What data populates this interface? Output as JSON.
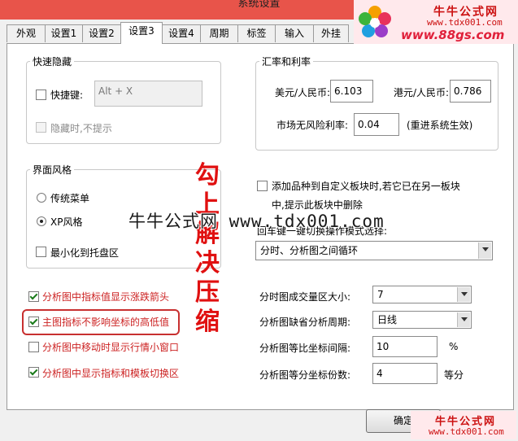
{
  "window": {
    "title": "系统设置"
  },
  "tabs": [
    "外观",
    "设置1",
    "设置2",
    "设置3",
    "设置4",
    "周期",
    "标签",
    "输入",
    "外挂"
  ],
  "active_tab": "设置3",
  "quick_hide": {
    "legend": "快速隐藏",
    "hotkey_label": "快捷键:",
    "hotkey_value": "Alt + X",
    "hide_label": "隐藏时,不提示"
  },
  "rates": {
    "legend": "汇率和利率",
    "usd_label": "美元/人民币:",
    "usd_value": "6.103",
    "hkd_label": "港元/人民币:",
    "hkd_value": "0.786",
    "riskfree_label": "市场无风险利率:",
    "riskfree_value": "0.04",
    "restart_note": "(重进系统生效)"
  },
  "style": {
    "legend": "界面风格",
    "classic_label": "传统菜单",
    "xp_label": "XP风格",
    "tray_label": "最小化到托盘区"
  },
  "custom_block": {
    "line1": "添加品种到自定义板块时,若它已在另一板块",
    "line2": "中,提示此板块中删除"
  },
  "switch_mode": {
    "label": "回车键一键切换操作模式选择:",
    "value": "分时、分析图之间循环"
  },
  "options": [
    {
      "label": "分析图中指标值显示涨跌箭头",
      "checked": true
    },
    {
      "label": "主图指标不影响坐标的高低值",
      "checked": true
    },
    {
      "label": "分析图中移动时显示行情小窗口",
      "checked": false
    },
    {
      "label": "分析图中显示指标和模板切换区",
      "checked": true
    }
  ],
  "right_fields": {
    "volume_label": "分时图成交量区大小:",
    "volume_value": "7",
    "period_label": "分析图缺省分析周期:",
    "period_value": "日线",
    "ratio_label": "分析图等比坐标间隔:",
    "ratio_value": "10",
    "ratio_unit": "%",
    "divide_label": "分析图等分坐标份数:",
    "divide_value": "4",
    "divide_unit": "等分"
  },
  "annotation": {
    "chars": [
      "勾",
      "上",
      "解",
      "决",
      "压",
      "缩"
    ]
  },
  "ok_button": "确定",
  "watermark": {
    "center": "牛牛公式网 www.tdx001.com",
    "top_brand": "牛牛公式网",
    "top_url1": "www.tdx001.com",
    "top_url2": "www.88gs.com",
    "bottom_brand": "牛牛公式网",
    "bottom_url": "www.tdx001.com"
  },
  "colors": {
    "title_bg": "#e8544a",
    "option_text": "#cc2222",
    "highlight": "#c83030"
  }
}
